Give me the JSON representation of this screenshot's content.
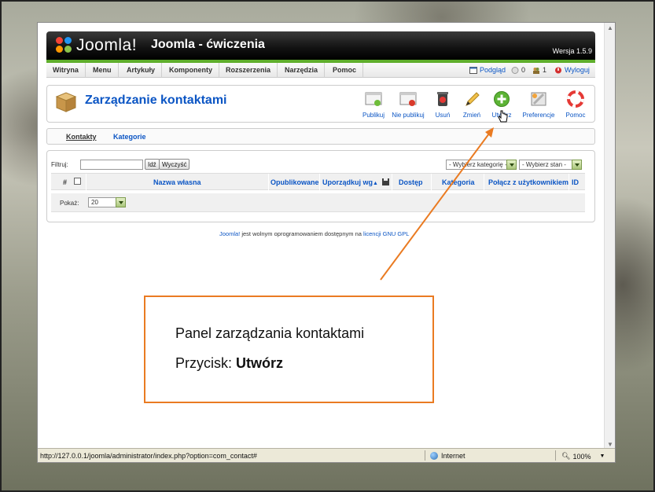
{
  "app": {
    "logo_text": "Joomla!",
    "site_title": "Joomla - ćwiczenia",
    "version": "Wersja 1.5.9"
  },
  "menu": {
    "items": [
      "Witryna",
      "Menu",
      "Artykuły",
      "Komponenty",
      "Rozszerzenia",
      "Narzędzia",
      "Pomoc"
    ],
    "preview": "Podgląd",
    "messages_count": "0",
    "users_count": "1",
    "logout": "Wyloguj"
  },
  "toolbar": {
    "title": "Zarządzanie kontaktami",
    "buttons": [
      "Publikuj",
      "Nie publikuj",
      "Usuń",
      "Zmień",
      "Utwórz",
      "Preferencje",
      "Pomoc"
    ]
  },
  "subtabs": [
    "Kontakty",
    "Kategorie"
  ],
  "filter": {
    "label": "Filtruj:",
    "value": "",
    "go_button": "Idź",
    "reset_button": "Wyczyść",
    "category_select": "- Wybierz kategorię -",
    "state_select": "- Wybierz stan -"
  },
  "table": {
    "headers": [
      "#",
      "Nazwa własna",
      "Opublikowane",
      "Uporządkuj wg",
      "Dostęp",
      "Kategoria",
      "Połącz z użytkownikiem",
      "ID"
    ]
  },
  "pagination": {
    "label": "Pokaż:",
    "value": "20"
  },
  "footer": {
    "link1": "Joomla!",
    "text": " jest wolnym oprogramowaniem dostępnym na ",
    "link2": "licencji GNU GPL"
  },
  "statusbar": {
    "url": "http://127.0.0.1/joomla/administrator/index.php?option=com_contact#",
    "zone": "Internet",
    "zoom": "100%"
  },
  "callout": {
    "line1": "Panel zarządzania kontaktami",
    "line2_prefix": "Przycisk: ",
    "line2_bold": "Utwórz"
  },
  "colors": {
    "accent_green": "#5fae2c",
    "link_blue": "#0b55c4",
    "callout_orange": "#ea7b22"
  }
}
